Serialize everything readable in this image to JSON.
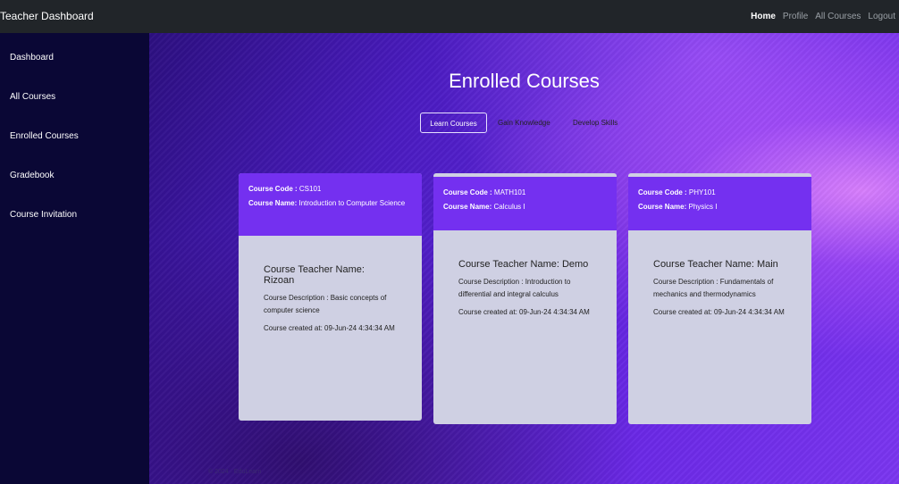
{
  "navbar": {
    "brand": "Teacher Dashboard",
    "links": [
      "Home",
      "Profile",
      "All Courses",
      "Logout"
    ]
  },
  "sidebar": {
    "items": [
      "Dashboard",
      "All Courses",
      "Enrolled Courses",
      "Gradebook",
      "Course Invitation"
    ]
  },
  "main": {
    "title": "Enrolled Courses",
    "tabs": [
      "Learn Courses",
      "Gain Knowledge",
      "Develop Skills"
    ],
    "labels": {
      "code": "Course Code :",
      "name": "Course Name:"
    },
    "cards": [
      {
        "code": "CS101",
        "name": "Introduction to Computer Science",
        "teacher": "Course Teacher Name: Rizoan",
        "description": "Course Description : Basic concepts of computer science",
        "created": "Course created at: 09-Jun-24 4:34:34 AM"
      },
      {
        "code": "MATH101",
        "name": "Calculus I",
        "teacher": "Course Teacher Name: Demo",
        "description": "Course Description : Introduction to differential and integral calculus",
        "created": "Course created at: 09-Jun-24 4:34:34 AM"
      },
      {
        "code": "PHY101",
        "name": "Physics I",
        "teacher": "Course Teacher Name: Main",
        "description": "Course Description : Fundamentals of mechanics and thermodynamics",
        "created": "Course created at: 09-Jun-24 4:34:34 AM"
      }
    ]
  },
  "footer": {
    "text": "© 2024 · EduLearn"
  }
}
